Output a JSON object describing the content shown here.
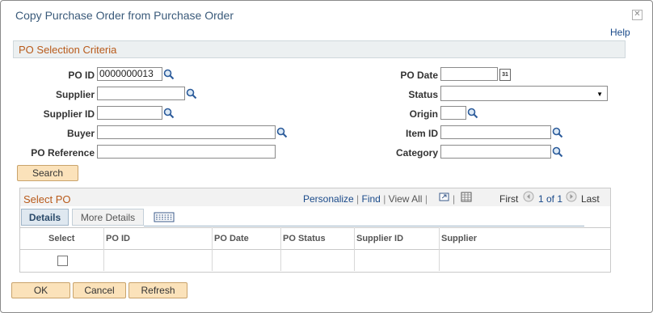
{
  "dialog": {
    "title": "Copy Purchase Order from Purchase Order",
    "close_glyph": "✕",
    "help": "Help"
  },
  "criteria": {
    "section_title": "PO Selection Criteria",
    "po_id_label": "PO ID",
    "po_id_value": "0000000013",
    "supplier_label": "Supplier",
    "supplier_value": "",
    "supplier_id_label": "Supplier ID",
    "supplier_id_value": "",
    "buyer_label": "Buyer",
    "buyer_value": "",
    "po_reference_label": "PO Reference",
    "po_reference_value": "",
    "po_date_label": "PO Date",
    "po_date_value": "",
    "status_label": "Status",
    "status_value": "",
    "origin_label": "Origin",
    "origin_value": "",
    "item_id_label": "Item ID",
    "item_id_value": "",
    "category_label": "Category",
    "category_value": "",
    "calendar_glyph": "31",
    "search_button": "Search"
  },
  "select_po": {
    "title": "Select PO",
    "personalize": "Personalize",
    "find": "Find",
    "sep": "|",
    "view_all": "View All",
    "first": "First",
    "page_info": "1 of 1",
    "last": "Last",
    "tabs": [
      {
        "label": "Details"
      },
      {
        "label": "More Details"
      }
    ],
    "columns": {
      "select": "Select",
      "po_id": "PO ID",
      "po_date": "PO Date",
      "po_status": "PO Status",
      "supplier_id": "Supplier ID",
      "supplier": "Supplier"
    }
  },
  "footer": {
    "ok": "OK",
    "cancel": "Cancel",
    "refresh": "Refresh"
  },
  "colors": {
    "accent": "#b85a1a",
    "link": "#1a4a8a",
    "button": "#fbe2ba"
  }
}
